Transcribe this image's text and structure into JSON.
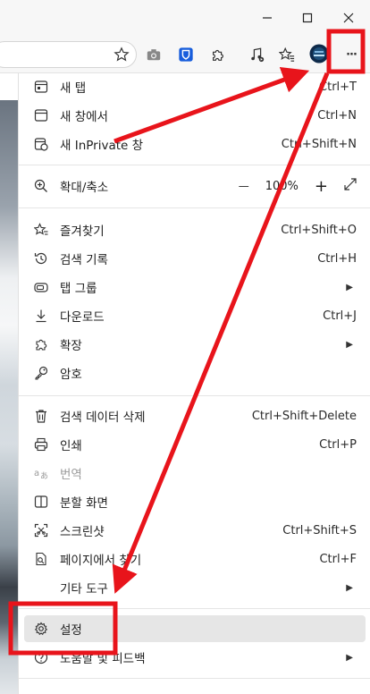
{
  "window": {
    "minimize_icon": "minimize-icon",
    "maximize_icon": "maximize-icon",
    "close_icon": "close-icon"
  },
  "toolbar": {
    "icons": [
      "star-icon",
      "camera-icon",
      "bitwarden-icon",
      "extensions-icon",
      "media-icon",
      "favorites-icon",
      "profile-avatar",
      "more-icon"
    ],
    "more_label": "···"
  },
  "menu": {
    "new_tab": {
      "label": "새 탭",
      "shortcut": "Ctrl+T"
    },
    "new_window": {
      "label": "새 창에서",
      "shortcut": "Ctrl+N"
    },
    "new_inprivate": {
      "label": "새 InPrivate 창",
      "shortcut": "Ctrl+Shift+N"
    },
    "zoom": {
      "label": "확대/축소",
      "minus": "—",
      "value": "100%",
      "plus": "+"
    },
    "favorites": {
      "label": "즐겨찾기",
      "shortcut": "Ctrl+Shift+O"
    },
    "history": {
      "label": "검색 기록",
      "shortcut": "Ctrl+H"
    },
    "tab_groups": {
      "label": "탭 그룹",
      "arrow": "▶"
    },
    "downloads": {
      "label": "다운로드",
      "shortcut": "Ctrl+J"
    },
    "extensions": {
      "label": "확장",
      "arrow": "▶"
    },
    "passwords": {
      "label": "암호"
    },
    "clear_data": {
      "label": "검색 데이터 삭제",
      "shortcut": "Ctrl+Shift+Delete"
    },
    "print": {
      "label": "인쇄",
      "shortcut": "Ctrl+P"
    },
    "translate": {
      "label": "번역"
    },
    "split_screen": {
      "label": "분할 화면"
    },
    "screenshot": {
      "label": "스크린샷",
      "shortcut": "Ctrl+Shift+S"
    },
    "find": {
      "label": "페이지에서 찾기",
      "shortcut": "Ctrl+F"
    },
    "more_tools": {
      "label": "기타 도구",
      "arrow": "▶"
    },
    "settings": {
      "label": "설정"
    },
    "help": {
      "label": "도움말 및 피드백",
      "arrow": "▶"
    }
  },
  "annotation_color": "#e8141b"
}
